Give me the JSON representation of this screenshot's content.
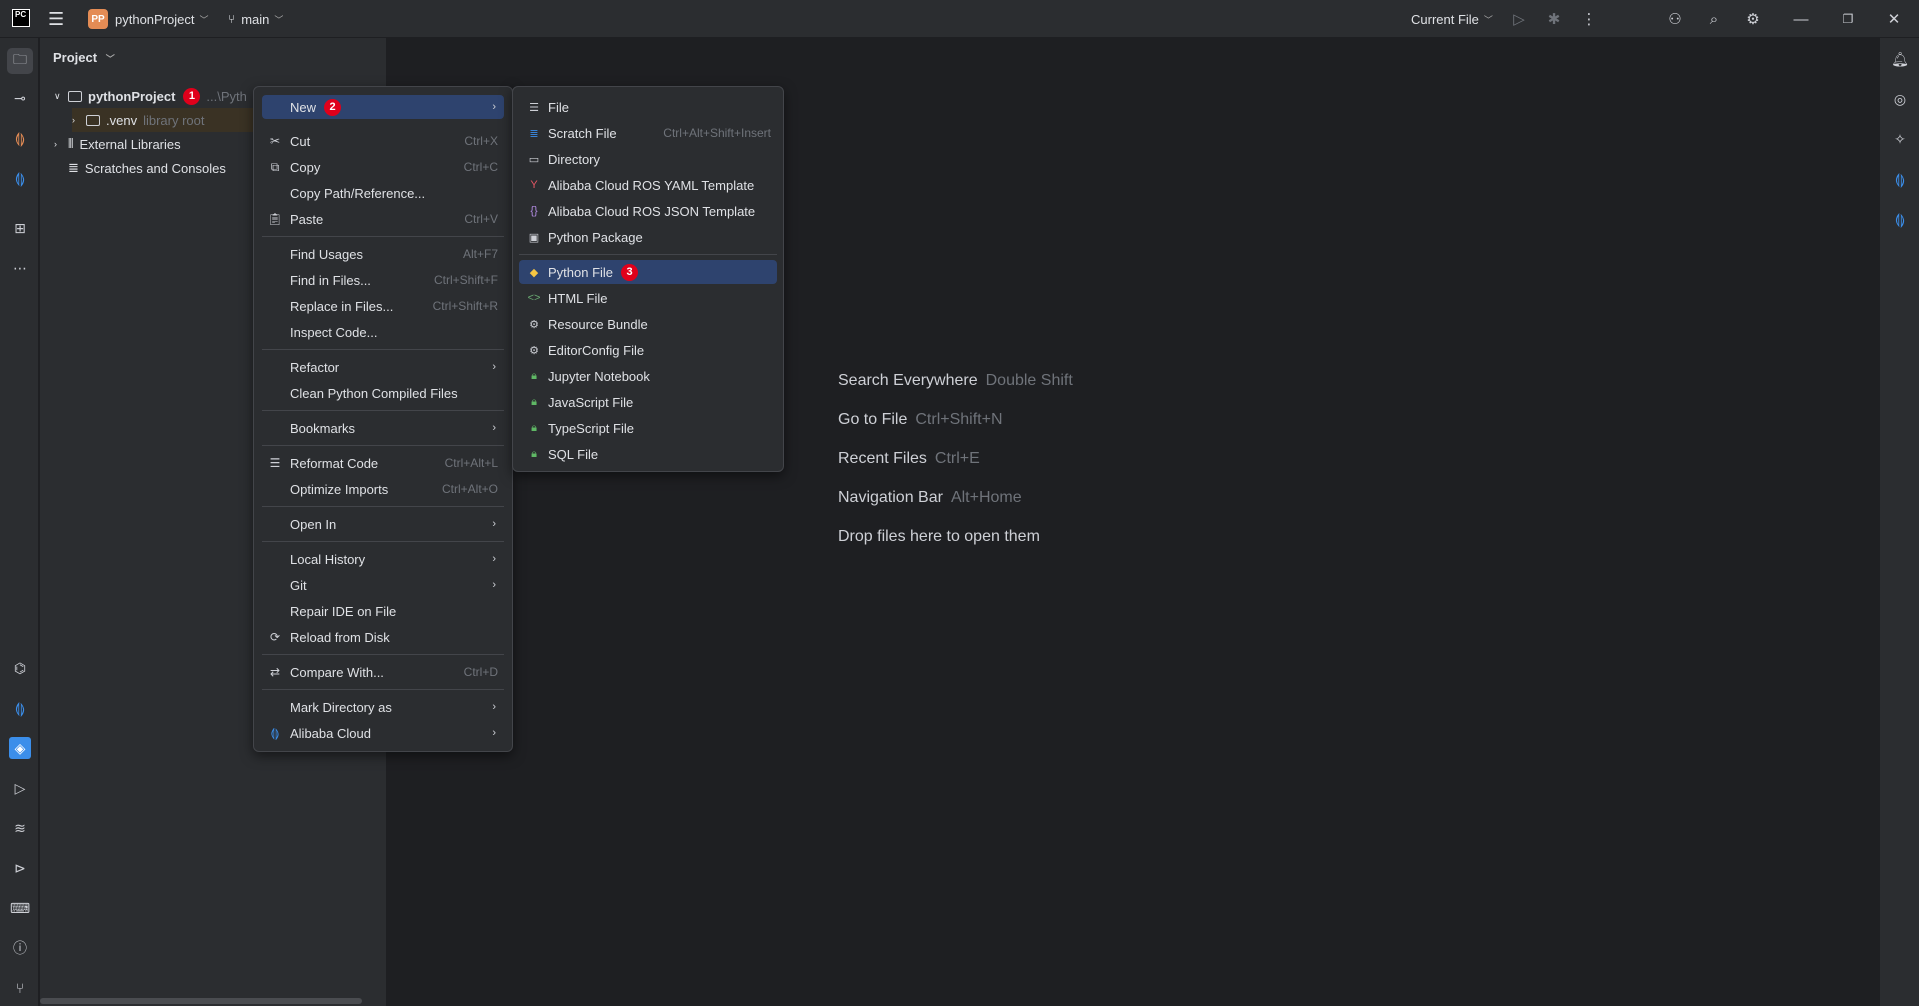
{
  "titlebar": {
    "app_logo": "PC",
    "project_badge": "PP",
    "project_name": "pythonProject",
    "branch": "main",
    "run_config": "Current File"
  },
  "project_panel": {
    "title": "Project",
    "tree": [
      {
        "label": "pythonProject",
        "suffix": "...\\Pyth",
        "badge": "1"
      },
      {
        "label": ".venv",
        "suffix": "library root"
      },
      {
        "label": "External Libraries"
      },
      {
        "label": "Scratches and Consoles"
      }
    ]
  },
  "context_menu": {
    "items": [
      {
        "label": "New",
        "badge": "2",
        "submenu": true,
        "selected": true
      },
      {
        "label": "Cut",
        "shortcut": "Ctrl+X",
        "icon": "scissors-icon"
      },
      {
        "label": "Copy",
        "shortcut": "Ctrl+C",
        "icon": "copy-icon"
      },
      {
        "label": "Copy Path/Reference..."
      },
      {
        "label": "Paste",
        "shortcut": "Ctrl+V",
        "icon": "paste-icon"
      },
      {
        "label": "Find Usages",
        "shortcut": "Alt+F7"
      },
      {
        "label": "Find in Files...",
        "shortcut": "Ctrl+Shift+F"
      },
      {
        "label": "Replace in Files...",
        "shortcut": "Ctrl+Shift+R"
      },
      {
        "label": "Inspect Code..."
      },
      {
        "label": "Refactor",
        "submenu": true
      },
      {
        "label": "Clean Python Compiled Files"
      },
      {
        "label": "Bookmarks",
        "submenu": true
      },
      {
        "label": "Reformat Code",
        "shortcut": "Ctrl+Alt+L",
        "icon": "reformat-icon"
      },
      {
        "label": "Optimize Imports",
        "shortcut": "Ctrl+Alt+O"
      },
      {
        "label": "Open In",
        "submenu": true
      },
      {
        "label": "Local History",
        "submenu": true
      },
      {
        "label": "Git",
        "submenu": true
      },
      {
        "label": "Repair IDE on File"
      },
      {
        "label": "Reload from Disk",
        "icon": "reload-icon"
      },
      {
        "label": "Compare With...",
        "shortcut": "Ctrl+D",
        "icon": "compare-icon"
      },
      {
        "label": "Mark Directory as",
        "submenu": true
      },
      {
        "label": "Alibaba Cloud",
        "submenu": true,
        "icon": "alibaba-cloud-icon"
      }
    ]
  },
  "new_submenu": {
    "items": [
      {
        "label": "File",
        "icon": "file-icon"
      },
      {
        "label": "Scratch File",
        "shortcut": "Ctrl+Alt+Shift+Insert",
        "icon": "scratch-file-icon"
      },
      {
        "label": "Directory",
        "icon": "folder-icon"
      },
      {
        "label": "Alibaba Cloud ROS YAML Template",
        "icon": "yaml-icon"
      },
      {
        "label": "Alibaba Cloud ROS JSON Template",
        "icon": "json-icon"
      },
      {
        "label": "Python Package",
        "icon": "package-icon"
      },
      {
        "label": "Python File",
        "badge": "3",
        "selected": true,
        "icon": "python-icon"
      },
      {
        "label": "HTML File",
        "icon": "html-icon"
      },
      {
        "label": "Resource Bundle",
        "icon": "gear-icon"
      },
      {
        "label": "EditorConfig File",
        "icon": "gear-icon"
      },
      {
        "label": "Jupyter Notebook",
        "icon": "lock-icon"
      },
      {
        "label": "JavaScript File",
        "icon": "lock-icon"
      },
      {
        "label": "TypeScript File",
        "icon": "lock-icon"
      },
      {
        "label": "SQL File",
        "icon": "lock-icon"
      }
    ]
  },
  "editor_hints": [
    {
      "label": "Search Everywhere",
      "key": "Double Shift"
    },
    {
      "label": "Go to File",
      "key": "Ctrl+Shift+N"
    },
    {
      "label": "Recent Files",
      "key": "Ctrl+E"
    },
    {
      "label": "Navigation Bar",
      "key": "Alt+Home"
    },
    {
      "label": "Drop files here to open them",
      "key": ""
    }
  ],
  "colors": {
    "background": "#1e1f22",
    "panel": "#2b2d30",
    "selection": "#2e436e",
    "badge": "#e0001b",
    "accent_orange": "#e48c55",
    "alibaba_blue": "#3b8eea"
  }
}
